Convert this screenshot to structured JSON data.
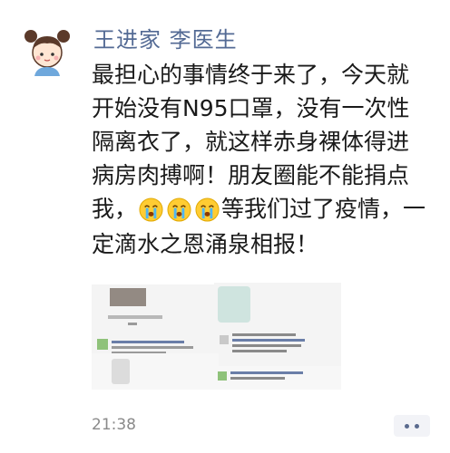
{
  "post": {
    "author": "王进家 李医生",
    "text_before_emoji": "最担心的事情终于来了，今天就开始没有N95口罩，没有一次性隔离衣了，就这样赤身裸体得进病房肉搏啊！朋友圈能不能捐点我，",
    "text_after_emoji": "等我们过了疫情，一定滴水之恩涌泉相报！",
    "emoji": [
      "crying-face",
      "crying-face",
      "crying-face"
    ],
    "time": "21:38"
  },
  "images": [
    {
      "name": "chat-screenshot-1"
    },
    {
      "name": "chat-screenshot-2"
    },
    {
      "name": "chat-screenshot-3"
    },
    {
      "name": "chat-screenshot-4"
    }
  ],
  "colors": {
    "author": "#536a94",
    "text": "#1a1a1a",
    "time": "#8a8a8a",
    "more_button_dots": "#5a6a8e"
  }
}
